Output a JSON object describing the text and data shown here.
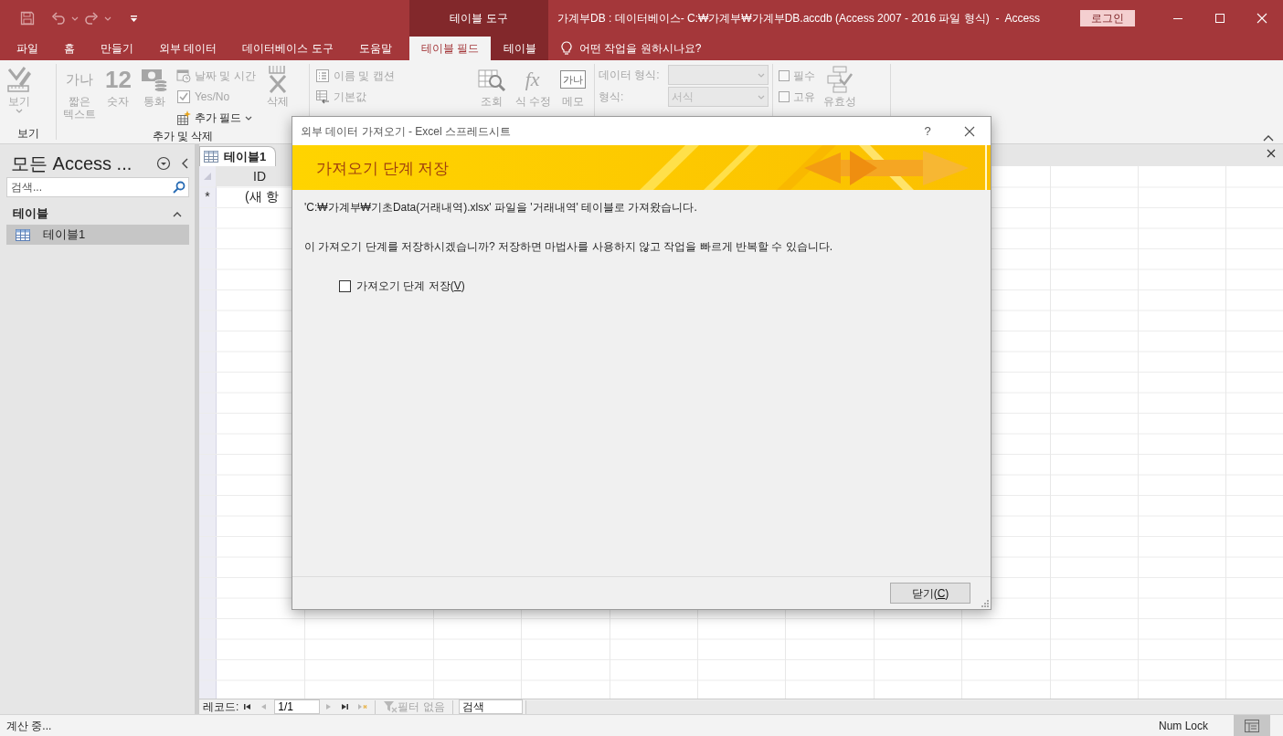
{
  "window": {
    "title": "가계부DB : 데이터베이스- C:₩가계부₩가계부DB.accdb (Access 2007 - 2016 파일 형식)  -  Access",
    "context_group": "테이블 도구",
    "sign_in": "로그인"
  },
  "ribbon_tabs": [
    {
      "label": "파일",
      "selected": false,
      "contextual": false
    },
    {
      "label": "홈",
      "selected": false,
      "contextual": false
    },
    {
      "label": "만들기",
      "selected": false,
      "contextual": false
    },
    {
      "label": "외부 데이터",
      "selected": false,
      "contextual": false
    },
    {
      "label": "데이터베이스 도구",
      "selected": false,
      "contextual": false
    },
    {
      "label": "도움말",
      "selected": false,
      "contextual": false
    },
    {
      "label": "테이블 필드",
      "selected": true,
      "contextual": true
    },
    {
      "label": "테이블",
      "selected": false,
      "contextual": true
    }
  ],
  "tell_me": "어떤 작업을 원하시나요?",
  "ribbon_groups": [
    {
      "label": "보기",
      "items": [
        {
          "kind": "large",
          "lines": [
            "보기"
          ],
          "dropdown": true,
          "disabled": true
        }
      ]
    },
    {
      "label": "추가 및 삭제",
      "items": [
        {
          "kind": "glyph",
          "glyph": "가나",
          "lines": [
            "짧은",
            "텍스트"
          ],
          "disabled": true
        },
        {
          "kind": "number",
          "glyph": "12",
          "lines": [
            "숫자"
          ],
          "disabled": true
        },
        {
          "kind": "large",
          "lines": [
            "통화"
          ],
          "disabled": true
        },
        {
          "kind": "stack",
          "items": [
            {
              "kind": "small",
              "label": "날짜 및 시간",
              "disabled": true
            },
            {
              "kind": "small",
              "label": "Yes/No",
              "disabled": true
            },
            {
              "kind": "small",
              "label": "추가 필드",
              "dropdown": true,
              "disabled": false
            }
          ]
        },
        {
          "kind": "large",
          "lines": [
            "삭제"
          ],
          "disabled": true
        }
      ]
    },
    {
      "items": [
        {
          "kind": "stack",
          "items": [
            {
              "kind": "small",
              "label": "이름 및 캡션",
              "disabled": true
            },
            {
              "kind": "small",
              "label": "기본값",
              "disabled": true
            }
          ]
        },
        {
          "kind": "large",
          "lines": [
            "조회"
          ],
          "disabled": true
        },
        {
          "kind": "formula",
          "glyph": "fx",
          "lines": [
            "식 수정"
          ],
          "disabled": true
        },
        {
          "kind": "memo",
          "glyph": "가나",
          "lines": [
            "메모"
          ],
          "disabled": true
        }
      ]
    },
    {
      "items": [
        {
          "kind": "combo",
          "label": "데이터 형식:",
          "disabled": true
        },
        {
          "kind": "combo",
          "label": "형식:",
          "value": "서식",
          "disabled": true
        }
      ]
    },
    {
      "items": [
        {
          "kind": "stack",
          "items": [
            {
              "kind": "check",
              "label": "필수",
              "checked": false,
              "disabled": true
            },
            {
              "kind": "check",
              "label": "고유",
              "checked": false,
              "disabled": true
            }
          ]
        },
        {
          "kind": "large",
          "lines": [
            "유효성"
          ],
          "disabled": true
        }
      ]
    }
  ],
  "nav_pane": {
    "title": "모든 Access ...",
    "search_placeholder": "검색...",
    "sections": [
      {
        "label": "테이블",
        "expanded": true,
        "items": [
          {
            "label": "테이블1",
            "selected": true
          }
        ]
      }
    ]
  },
  "document": {
    "tabs": [
      {
        "label": "테이블1",
        "selected": true
      }
    ],
    "columns": [
      {
        "label": "ID"
      }
    ],
    "new_row": {
      "marker": "*",
      "cells": [
        "(새 항"
      ]
    }
  },
  "record_nav": {
    "label": "레코드:",
    "position": "1/1",
    "buttons": [
      {
        "disabled": false
      },
      {
        "disabled": true
      },
      {
        "disabled": true
      },
      {
        "disabled": false
      },
      {
        "disabled": true
      }
    ],
    "filter": {
      "label": "필터 없음",
      "disabled": true
    },
    "search_placeholder": "검색"
  },
  "status_bar": {
    "text": "계산 중...",
    "indicators": [
      "Num Lock"
    ],
    "views": [
      {
        "selected": true
      }
    ]
  },
  "dialog": {
    "title": "외부 데이터 가져오기 - Excel 스프레드시트",
    "help": "?",
    "heading": "가져오기 단계 저장",
    "paragraphs": [
      "'C:₩가계부₩기초Data(거래내역).xlsx' 파일을 '거래내역' 테이블로 가져왔습니다.",
      "이 가져오기 단계를 저장하시겠습니까? 저장하면 마법사를 사용하지 않고 작업을 빠르게 반복할 수 있습니다."
    ],
    "checkbox": {
      "label": "가져오기 단계 저장(",
      "access_key": "V",
      "label_end": ")",
      "checked": false
    },
    "buttons": [
      {
        "label": "닫기(",
        "access_key": "C",
        "label_end": ")"
      }
    ]
  }
}
